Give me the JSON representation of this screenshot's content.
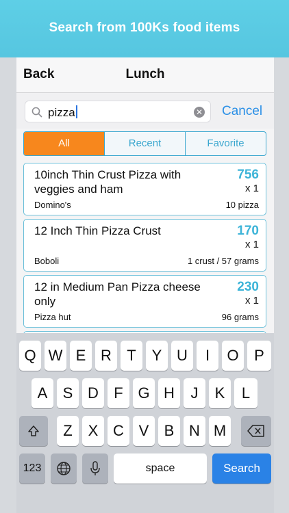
{
  "banner": {
    "text": "Search from 100Ks food items"
  },
  "navbar": {
    "back_label": "Back",
    "title": "Lunch"
  },
  "search": {
    "value": "pizza",
    "cancel_label": "Cancel"
  },
  "segments": [
    {
      "label": "All",
      "active": true
    },
    {
      "label": "Recent",
      "active": false
    },
    {
      "label": "Favorite",
      "active": false
    }
  ],
  "results": [
    {
      "name": "10inch Thin Crust Pizza with veggies and ham",
      "calories": "756",
      "qty": "x 1",
      "brand": "Domino's",
      "serving": "10 pizza"
    },
    {
      "name": "12 Inch Thin Pizza Crust",
      "calories": "170",
      "qty": "x 1",
      "brand": "Boboli",
      "serving": "1 crust / 57 grams"
    },
    {
      "name": "12 in Medium Pan Pizza cheese only",
      "calories": "230",
      "qty": "x 1",
      "brand": "Pizza hut",
      "serving": "96 grams"
    }
  ],
  "keyboard": {
    "row1": [
      "Q",
      "W",
      "E",
      "R",
      "T",
      "Y",
      "U",
      "I",
      "O",
      "P"
    ],
    "row2": [
      "A",
      "S",
      "D",
      "F",
      "G",
      "H",
      "J",
      "K",
      "L"
    ],
    "row3": [
      "Z",
      "X",
      "C",
      "V",
      "B",
      "N",
      "M"
    ],
    "numbers_label": "123",
    "space_label": "space",
    "search_label": "Search"
  },
  "colors": {
    "accent": "#3db4d8",
    "active_segment": "#f7871d",
    "cancel": "#2a8fe6"
  }
}
